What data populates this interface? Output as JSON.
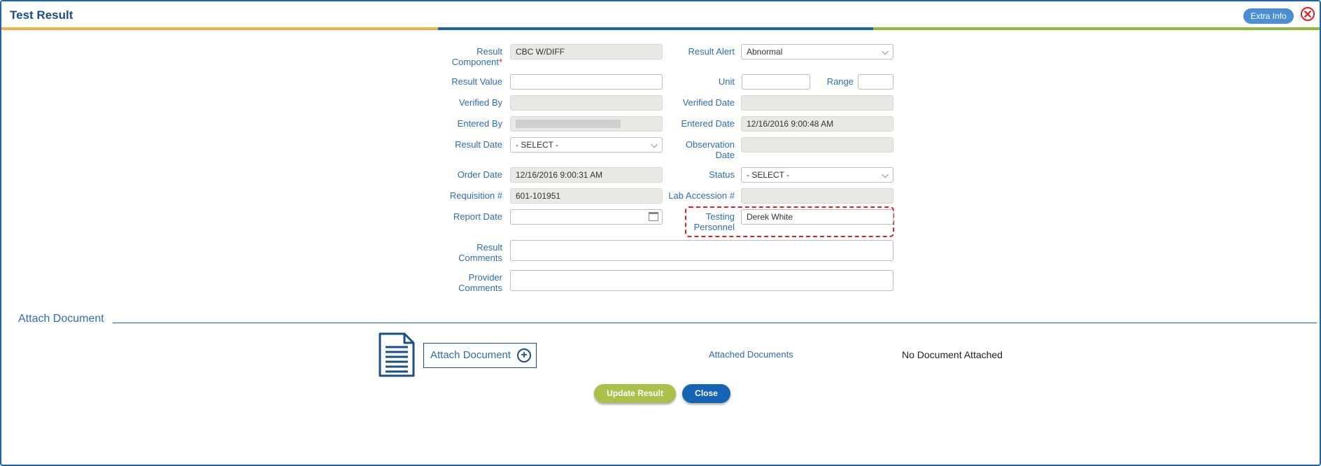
{
  "window": {
    "title": "Test Result",
    "extra_info_label": "Extra Info",
    "close_glyph": "✕"
  },
  "form": {
    "result_component": {
      "label": "Result Component",
      "required_mark": "*",
      "value": "CBC W/DIFF"
    },
    "result_alert": {
      "label": "Result Alert",
      "value": "Abnormal"
    },
    "result_value": {
      "label": "Result Value",
      "value": ""
    },
    "unit": {
      "label": "Unit",
      "value": ""
    },
    "range": {
      "label": "Range",
      "value": ""
    },
    "verified_by": {
      "label": "Verified By",
      "value": ""
    },
    "verified_date": {
      "label": "Verified Date",
      "value": ""
    },
    "entered_by": {
      "label": "Entered By",
      "value": ""
    },
    "entered_date": {
      "label": "Entered Date",
      "value": "12/16/2016 9:00:48 AM"
    },
    "result_date": {
      "label": "Result Date",
      "value": "- SELECT -"
    },
    "observation_date": {
      "label": "Observation Date",
      "value": ""
    },
    "order_date": {
      "label": "Order Date",
      "value": "12/16/2016 9:00:31 AM"
    },
    "status": {
      "label": "Status",
      "value": "- SELECT -"
    },
    "requisition": {
      "label": "Requisition #",
      "value": "601-101951"
    },
    "lab_accession": {
      "label": "Lab Accession #",
      "value": ""
    },
    "report_date": {
      "label": "Report Date",
      "value": ""
    },
    "testing_personnel": {
      "label": "Testing Personnel",
      "value": "Derek White"
    },
    "result_comments": {
      "label": "Result Comments",
      "value": ""
    },
    "provider_comments": {
      "label": "Provider Comments",
      "value": ""
    }
  },
  "attach": {
    "section_title": "Attach Document",
    "button_label": "Attach Document",
    "attached_label": "Attached Documents",
    "status_text": "No Document Attached"
  },
  "actions": {
    "update_label": "Update Result",
    "close_label": "Close"
  },
  "colors": {
    "brand_blue": "#1a63ae",
    "stripe_orange": "#f0b34a",
    "stripe_green": "#8dbb3c",
    "update_green": "#a9c04a",
    "highlight_red": "#e02020"
  },
  "icons": [
    "close-icon",
    "chevron-down-icon",
    "calendar-icon",
    "document-icon",
    "plus-circle-icon"
  ]
}
